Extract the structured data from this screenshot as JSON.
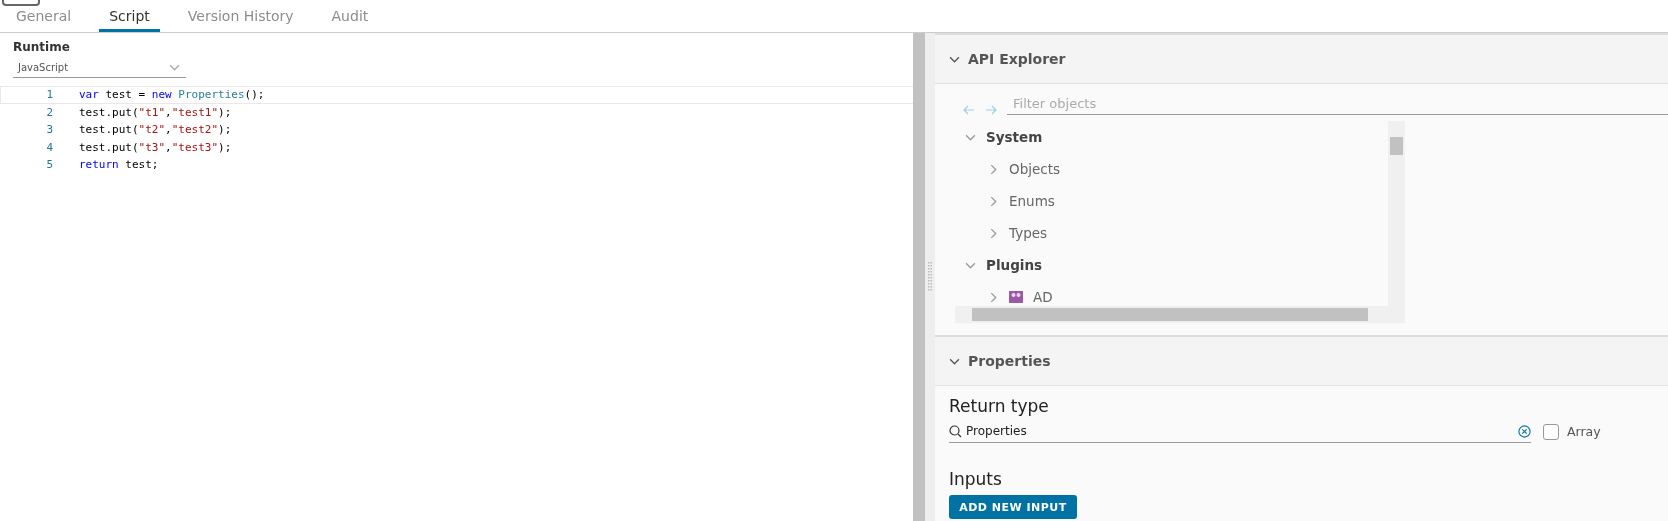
{
  "tabs": [
    {
      "label": "General",
      "selected": false
    },
    {
      "label": "Script",
      "selected": true
    },
    {
      "label": "Version History",
      "selected": false
    },
    {
      "label": "Audit",
      "selected": false
    }
  ],
  "runtime": {
    "label": "Runtime",
    "value": "JavaScript"
  },
  "code": {
    "lines": [
      {
        "number": "1",
        "current": true,
        "tokens": [
          {
            "kind": "keyword",
            "text": "var"
          },
          {
            "kind": "plain",
            "text": " test = "
          },
          {
            "kind": "keyword",
            "text": "new"
          },
          {
            "kind": "class",
            "text": " Properties"
          },
          {
            "kind": "plain",
            "text": "();"
          }
        ]
      },
      {
        "number": "2",
        "current": false,
        "tokens": [
          {
            "kind": "plain",
            "text": "test.put("
          },
          {
            "kind": "string",
            "text": "\"t1\""
          },
          {
            "kind": "plain",
            "text": ","
          },
          {
            "kind": "string",
            "text": "\"test1\""
          },
          {
            "kind": "plain",
            "text": ");"
          }
        ]
      },
      {
        "number": "3",
        "current": false,
        "tokens": [
          {
            "kind": "plain",
            "text": "test.put("
          },
          {
            "kind": "string",
            "text": "\"t2\""
          },
          {
            "kind": "plain",
            "text": ","
          },
          {
            "kind": "string",
            "text": "\"test2\""
          },
          {
            "kind": "plain",
            "text": ");"
          }
        ]
      },
      {
        "number": "4",
        "current": false,
        "tokens": [
          {
            "kind": "plain",
            "text": "test.put("
          },
          {
            "kind": "string",
            "text": "\"t3\""
          },
          {
            "kind": "plain",
            "text": ","
          },
          {
            "kind": "string",
            "text": "\"test3\""
          },
          {
            "kind": "plain",
            "text": ");"
          }
        ]
      },
      {
        "number": "5",
        "current": false,
        "tokens": [
          {
            "kind": "keyword",
            "text": "return"
          },
          {
            "kind": "plain",
            "text": " test;"
          }
        ]
      }
    ]
  },
  "api_explorer": {
    "title": "API Explorer",
    "expanded": true,
    "filter": {
      "placeholder": "Filter objects"
    },
    "tree": [
      {
        "label": "System",
        "expanded": true,
        "children": [
          {
            "label": "Objects",
            "expanded": false
          },
          {
            "label": "Enums",
            "expanded": false
          },
          {
            "label": "Types",
            "expanded": false
          }
        ]
      },
      {
        "label": "Plugins",
        "expanded": true,
        "children": [
          {
            "label": "AD",
            "expanded": false,
            "kind": "plugin"
          }
        ]
      }
    ]
  },
  "properties": {
    "title": "Properties",
    "expanded": true,
    "return_type": {
      "label": "Return type",
      "value": "Properties",
      "array_label": "Array",
      "array_checked": false
    },
    "inputs": {
      "label": "Inputs",
      "button": "ADD NEW INPUT"
    }
  }
}
